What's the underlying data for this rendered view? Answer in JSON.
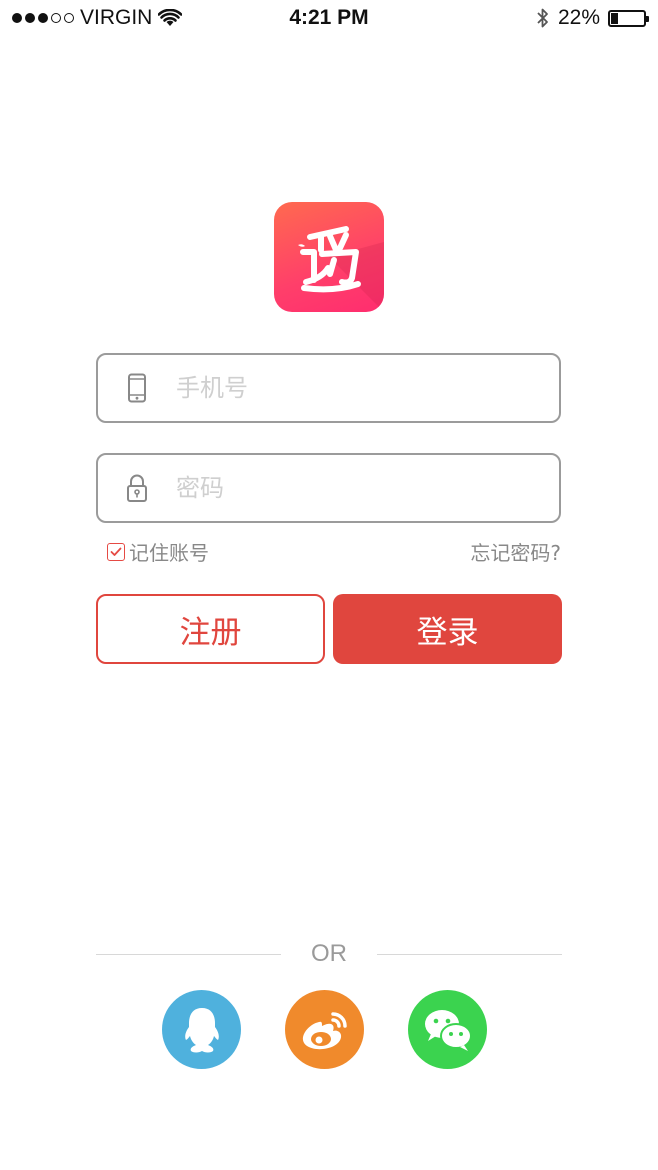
{
  "status_bar": {
    "carrier": "VIRGIN",
    "time": "4:21 PM",
    "battery": "22%",
    "battery_level": 0.22,
    "signal_bars_filled": 3,
    "signal_bars_total": 5
  },
  "form": {
    "phone_placeholder": "手机号",
    "password_placeholder": "密码",
    "remember_label": "记住账号",
    "remember_checked": true,
    "forgot_label": "忘记密码?"
  },
  "buttons": {
    "register": "注册",
    "login": "登录"
  },
  "divider": {
    "or": "OR"
  },
  "social": [
    {
      "name": "qq-icon",
      "color": "#4fb1dd"
    },
    {
      "name": "weibo-icon",
      "color": "#f08a2c"
    },
    {
      "name": "wechat-icon",
      "color": "#3bd34f"
    }
  ],
  "colors": {
    "accent": "#e0463e",
    "logo_gradient_start": "#ff6a4f",
    "logo_gradient_end": "#ff2d6f"
  }
}
